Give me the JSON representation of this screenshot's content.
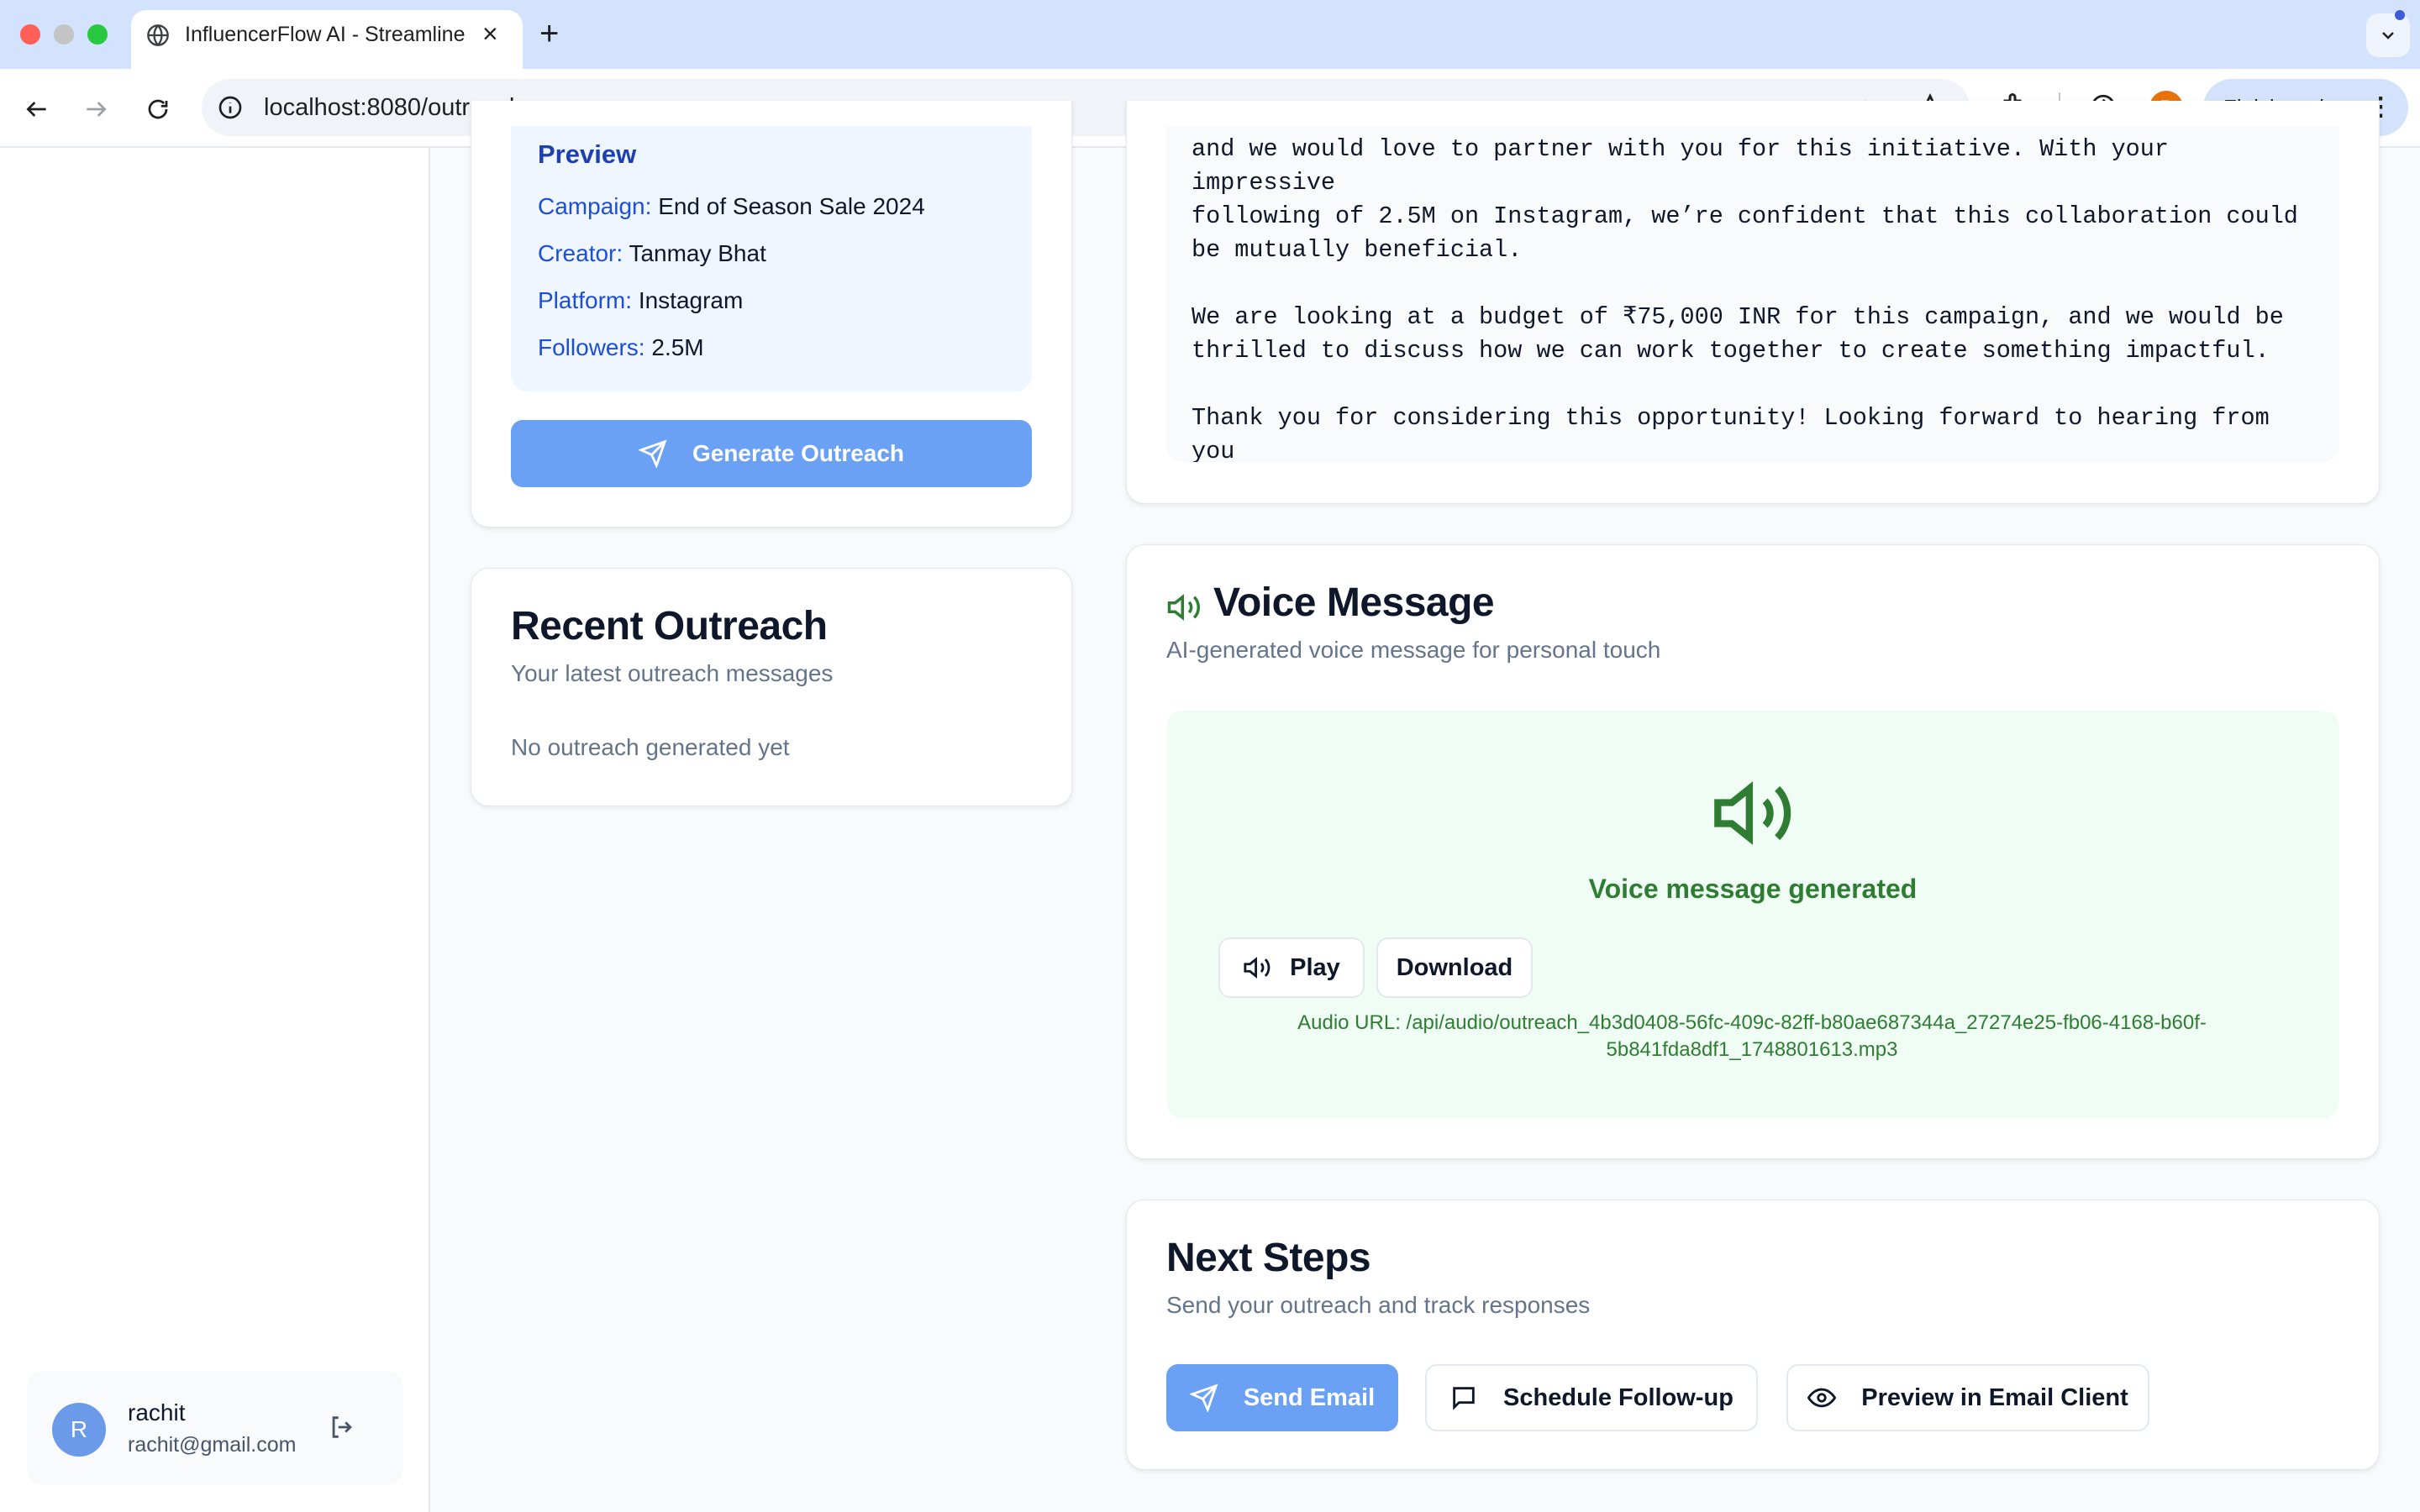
{
  "browser": {
    "tab_title": "InfluencerFlow AI - Streamline",
    "url": "localhost:8080/outreach",
    "finish_update_label": "Finish update",
    "profile_initial": "R"
  },
  "preview": {
    "title": "Preview",
    "campaign_label": "Campaign:",
    "campaign_value": "End of Season Sale 2024",
    "creator_label": "Creator:",
    "creator_value": "Tanmay Bhat",
    "platform_label": "Platform:",
    "platform_value": "Instagram",
    "followers_label": "Followers:",
    "followers_value": "2.5M",
    "generate_label": "Generate Outreach"
  },
  "recent": {
    "title": "Recent Outreach",
    "subtitle": "Your latest outreach messages",
    "empty": "No outreach generated yet"
  },
  "email": {
    "body": "and we would love to partner with you for this initiative. With your impressive\nfollowing of 2.5M on Instagram, we’re confident that this collaboration could\nbe mutually beneficial.\n\nWe are looking at a budget of ₹75,000 INR for this campaign, and we would be\nthrilled to discuss how we can work together to create something impactful.\n\nThank you for considering this opportunity! Looking forward to hearing from you\nsoon."
  },
  "voice": {
    "title": "Voice Message",
    "subtitle": "AI-generated voice message for personal touch",
    "status": "Voice message generated",
    "play_label": "Play",
    "download_label": "Download",
    "audio_url": "Audio URL: /api/audio/outreach_4b3d0408-56fc-409c-82ff-b80ae687344a_27274e25-fb06-4168-b60f-5b841fda8df1_1748801613.mp3"
  },
  "next_steps": {
    "title": "Next Steps",
    "subtitle": "Send your outreach and track responses",
    "send_label": "Send Email",
    "schedule_label": "Schedule Follow-up",
    "preview_label": "Preview in Email Client"
  },
  "user": {
    "initial": "R",
    "name": "rachit",
    "email": "rachit@gmail.com"
  },
  "colors": {
    "primary": "#6ba1f5",
    "success": "#2e7d32",
    "preview_bg": "#eff6ff",
    "voice_bg": "#f0fdf4"
  }
}
